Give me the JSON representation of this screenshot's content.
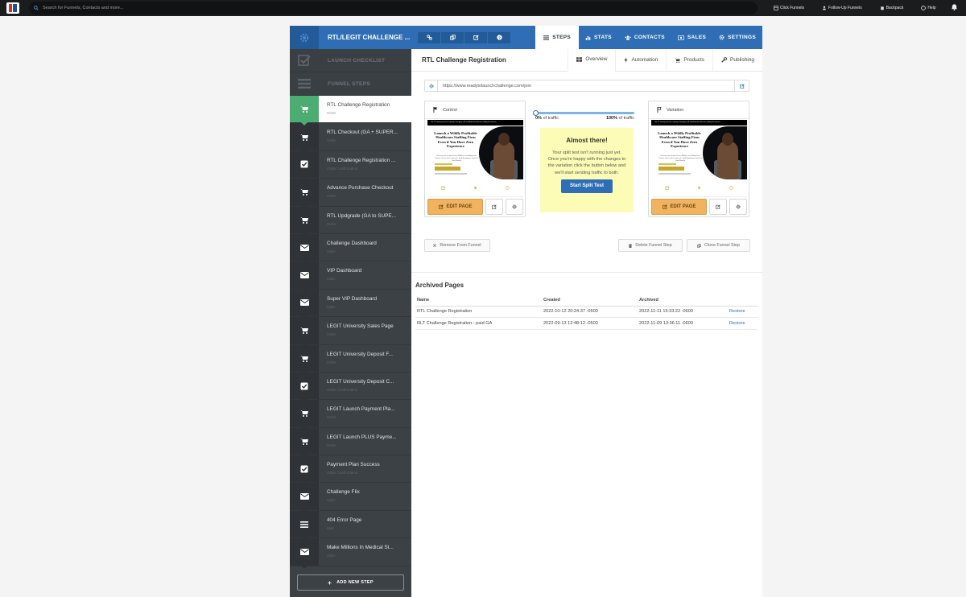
{
  "topbar": {
    "search_placeholder": "Search for Funnels, Contacts and more...",
    "nav": [
      "Click Funnels",
      "Follow-Up Funnels",
      "Backpack",
      "Help"
    ]
  },
  "funnel": {
    "title": "RTL/LEGIT CHALLENGE ...",
    "tabs": [
      "STEPS",
      "STATS",
      "CONTACTS",
      "SALES",
      "SETTINGS"
    ]
  },
  "sidebar": {
    "launch_checklist": "LAUNCH CHECKLIST",
    "funnel_steps": "FUNNEL STEPS",
    "steps": [
      {
        "name": "RTL Challenge Registration",
        "type": "Order",
        "icon": "cart-icon"
      },
      {
        "name": "RTL Checkout (GA + SUPER...",
        "type": "Order",
        "icon": "cart-icon"
      },
      {
        "name": "RTL Challenge Registration ...",
        "type": "Order Confirmation",
        "icon": "check-icon"
      },
      {
        "name": "Advance Purchase Checkout",
        "type": "Order",
        "icon": "cart-icon"
      },
      {
        "name": "RTL Updgrade (GA to SUPE...",
        "type": "Order",
        "icon": "cart-icon"
      },
      {
        "name": "Challenge Dashboard",
        "type": "Optin",
        "icon": "envelope-icon"
      },
      {
        "name": "VIP Dashboard",
        "type": "Optin",
        "icon": "envelope-icon"
      },
      {
        "name": "Super VIP Dashboard",
        "type": "Optin",
        "icon": "envelope-icon"
      },
      {
        "name": "LEGIT University Sales Page",
        "type": "Order",
        "icon": "cart-icon"
      },
      {
        "name": "LEGIT University Deposit F...",
        "type": "Order",
        "icon": "cart-icon"
      },
      {
        "name": "LEGIT University Deposit C...",
        "type": "Order Confirmation",
        "icon": "check-icon"
      },
      {
        "name": "LEGIT Launch Payment Pla...",
        "type": "Order",
        "icon": "cart-icon"
      },
      {
        "name": "LEGIT Launch PLUS Payme...",
        "type": "Order",
        "icon": "cart-icon"
      },
      {
        "name": "Payment Plan Success",
        "type": "Order Confirmation",
        "icon": "check-icon"
      },
      {
        "name": "Challenge FIix",
        "type": "Optin",
        "icon": "envelope-icon"
      },
      {
        "name": "404 Error Page",
        "type": "Misc",
        "icon": "list-icon"
      },
      {
        "name": "Make Millions In Medical St...",
        "type": "Optin",
        "icon": "envelope-icon"
      }
    ],
    "add_step": "ADD NEW STEP"
  },
  "page": {
    "title": "RTL Challenge Registration",
    "tabs": [
      "Overview",
      "Automation",
      "Products",
      "Publishing"
    ],
    "url": "https://www.readytolaunchchallenge.com/join"
  },
  "variants": {
    "control_label": "Control",
    "variation_label": "Variation",
    "edit_label": "EDIT PAGE",
    "thumb_bar": "The #1 training event for aspiring, emerging, and established healthcare staffing firm owners",
    "thumb_headline": "Launch a Wildly Profitable Healthcare Staffing Firm Even if You Have Zero Experience",
    "thumb_sub": "Discover the Insider Secret Millions of Staffing Firm Owners Use to Get Contracts, Staff Employees and Get Paid Weekly"
  },
  "split_test": {
    "control_pct_value": "0%",
    "control_pct_label": "of traffic",
    "variation_pct_value": "100%",
    "variation_pct_label": "of traffic",
    "control_fraction": 0,
    "heading": "Almost there!",
    "body": "Your split test isn't running just yet. Once you're happy with the changes to the variation click the button below and we'll start sending traffic to both.",
    "button": "Start Split Test"
  },
  "actions": {
    "remove": "Remove From Funnel",
    "delete": "Delete Funnel Step",
    "clone": "Clone Funnel Step"
  },
  "archived": {
    "title": "Archived Pages",
    "columns": [
      "Name",
      "Created",
      "Archived",
      ""
    ],
    "rows": [
      {
        "name": "RTL Challenge Registration",
        "created": "2022-10-12 20:24:37 -0500",
        "archived": "2022-11-11 15:33:22 -0600",
        "action": "Restore"
      },
      {
        "name": "RLT Challenge Registration - paid GA",
        "created": "2022-09-13 12:48:12 -0500",
        "archived": "2022-11-09 13:36:11 -0600",
        "action": "Restore"
      }
    ]
  },
  "colors": {
    "primary": "#2f6eb5",
    "sidebar": "#3c4146",
    "active_step": "#4cad73",
    "edit_button": "#f2b360",
    "notice": "#fcfcb6"
  }
}
